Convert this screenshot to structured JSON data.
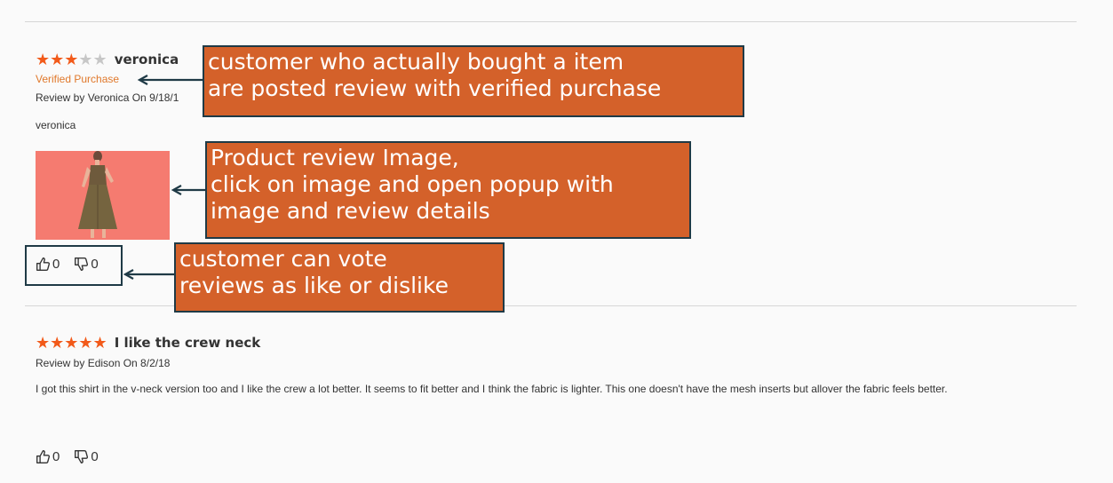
{
  "reviews": [
    {
      "stars_on": "★★★",
      "stars_off": "★★",
      "title": "veronica",
      "verified": "Verified Purchase",
      "meta": "Review by Veronica On 9/18/1",
      "body": "veronica",
      "likes": "0",
      "dislikes": "0"
    },
    {
      "stars_on": "★★★★★",
      "stars_off": "",
      "title": "I like the crew neck",
      "meta": "Review by Edison On 8/2/18",
      "body": "I got this shirt in the v-neck version too and I like the crew a lot better. It seems to fit better and I think the fabric is lighter. This one doesn't have the mesh inserts but allover the fabric feels better.",
      "likes": "0",
      "dislikes": "0"
    }
  ],
  "callouts": {
    "verified": [
      "customer who actually bought a item",
      "are posted review with verified purchase"
    ],
    "image": [
      "Product review Image,",
      "click on image and open popup with",
      "image and review details"
    ],
    "votes": [
      "customer can vote",
      "reviews as like or dislike"
    ]
  },
  "colors": {
    "star": "#f25a1a",
    "verified": "#e0782b",
    "callout_bg": "#d4612a",
    "callout_border": "#1f3a46",
    "image_bg": "#f57b70"
  }
}
